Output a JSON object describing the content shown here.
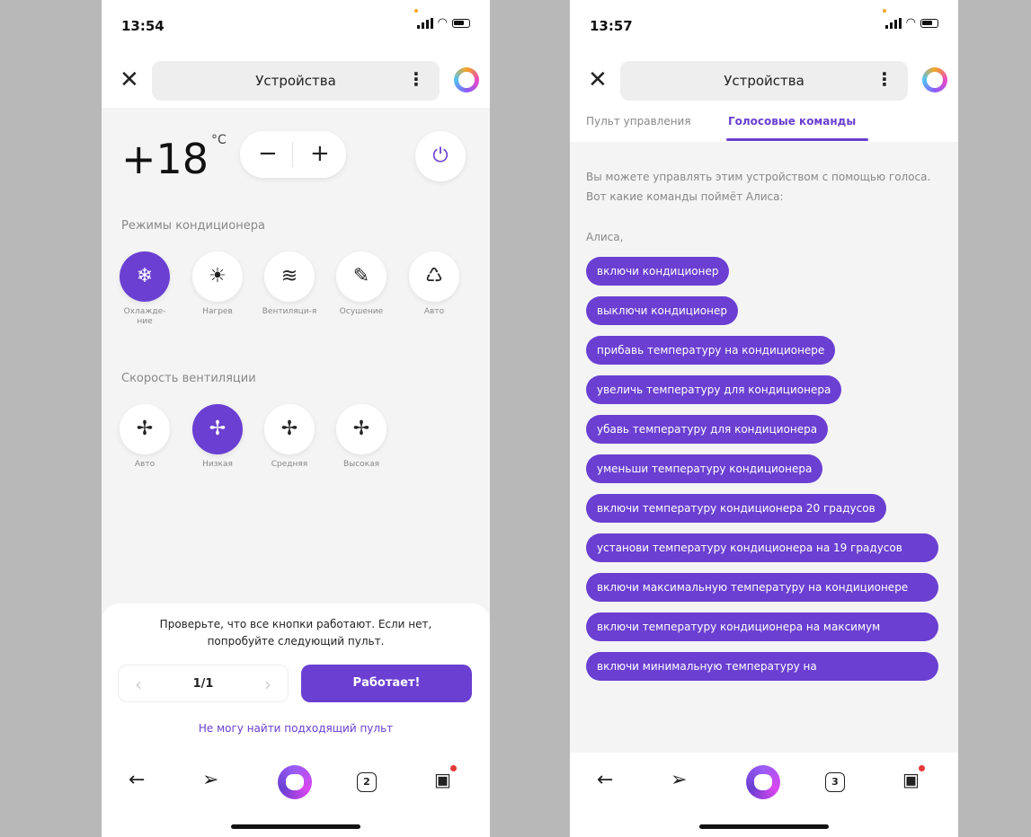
{
  "left": {
    "time": "13:54",
    "title": "Устройства",
    "temperature": "+18",
    "temperature_unit": "°C",
    "minus": "−",
    "plus": "+",
    "modes_label": "Режимы кондиционера",
    "modes": [
      {
        "label": "Охлажде-ние",
        "icon": "snowflake-icon",
        "glyph": "❄",
        "active": true
      },
      {
        "label": "Нагрев",
        "icon": "sun-icon",
        "glyph": "☀",
        "active": false
      },
      {
        "label": "Вентиляци-я",
        "icon": "wind-icon",
        "glyph": "≋",
        "active": false
      },
      {
        "label": "Осушение",
        "icon": "drop-off-icon",
        "glyph": "✎",
        "active": false
      },
      {
        "label": "Авто",
        "icon": "recycle-icon",
        "glyph": "♺",
        "active": false
      }
    ],
    "speed_label": "Скорость вентиляции",
    "speeds": [
      {
        "label": "Авто",
        "icon": "fan-icon",
        "glyph": "✢",
        "active": false
      },
      {
        "label": "Низкая",
        "icon": "fan-icon",
        "glyph": "✢",
        "active": true
      },
      {
        "label": "Средняя",
        "icon": "fan-icon",
        "glyph": "✢",
        "active": false
      },
      {
        "label": "Высокая",
        "icon": "fan-icon",
        "glyph": "✢",
        "active": false
      }
    ],
    "sheet_text": "Проверьте, что все кнопки работают. Если нет, попробуйте следующий пульт.",
    "pager": "1/1",
    "works_button": "Работает!",
    "cant_find": "Не могу найти подходящий пульт",
    "tabs_count": "2"
  },
  "right": {
    "time": "13:57",
    "title": "Устройства",
    "tab_remote": "Пульт управления",
    "tab_voice": "Голосовые команды",
    "intro": "Вы можете управлять этим устройством с помощью голоса. Вот какие команды поймёт Алиса:",
    "alisa": "Алиса,",
    "commands": [
      "включи кондиционер",
      "выключи кондиционер",
      "прибавь температуру на кондиционере",
      "увеличь температуру для кондиционера",
      "убавь температуру для кондиционера",
      "уменьши температуру кондиционера",
      "включи температуру кондиционера 20 градусов",
      "установи температуру кондиционера на 19 градусов",
      "включи максимальную температуру на кондиционере",
      "включи температуру кондиционера на максимум",
      "включи минимальную температуру на"
    ],
    "tabs_count": "3"
  },
  "colors": {
    "accent": "#6a3fd1",
    "background": "#f4f4f5",
    "frame": "#b8b8b8"
  }
}
